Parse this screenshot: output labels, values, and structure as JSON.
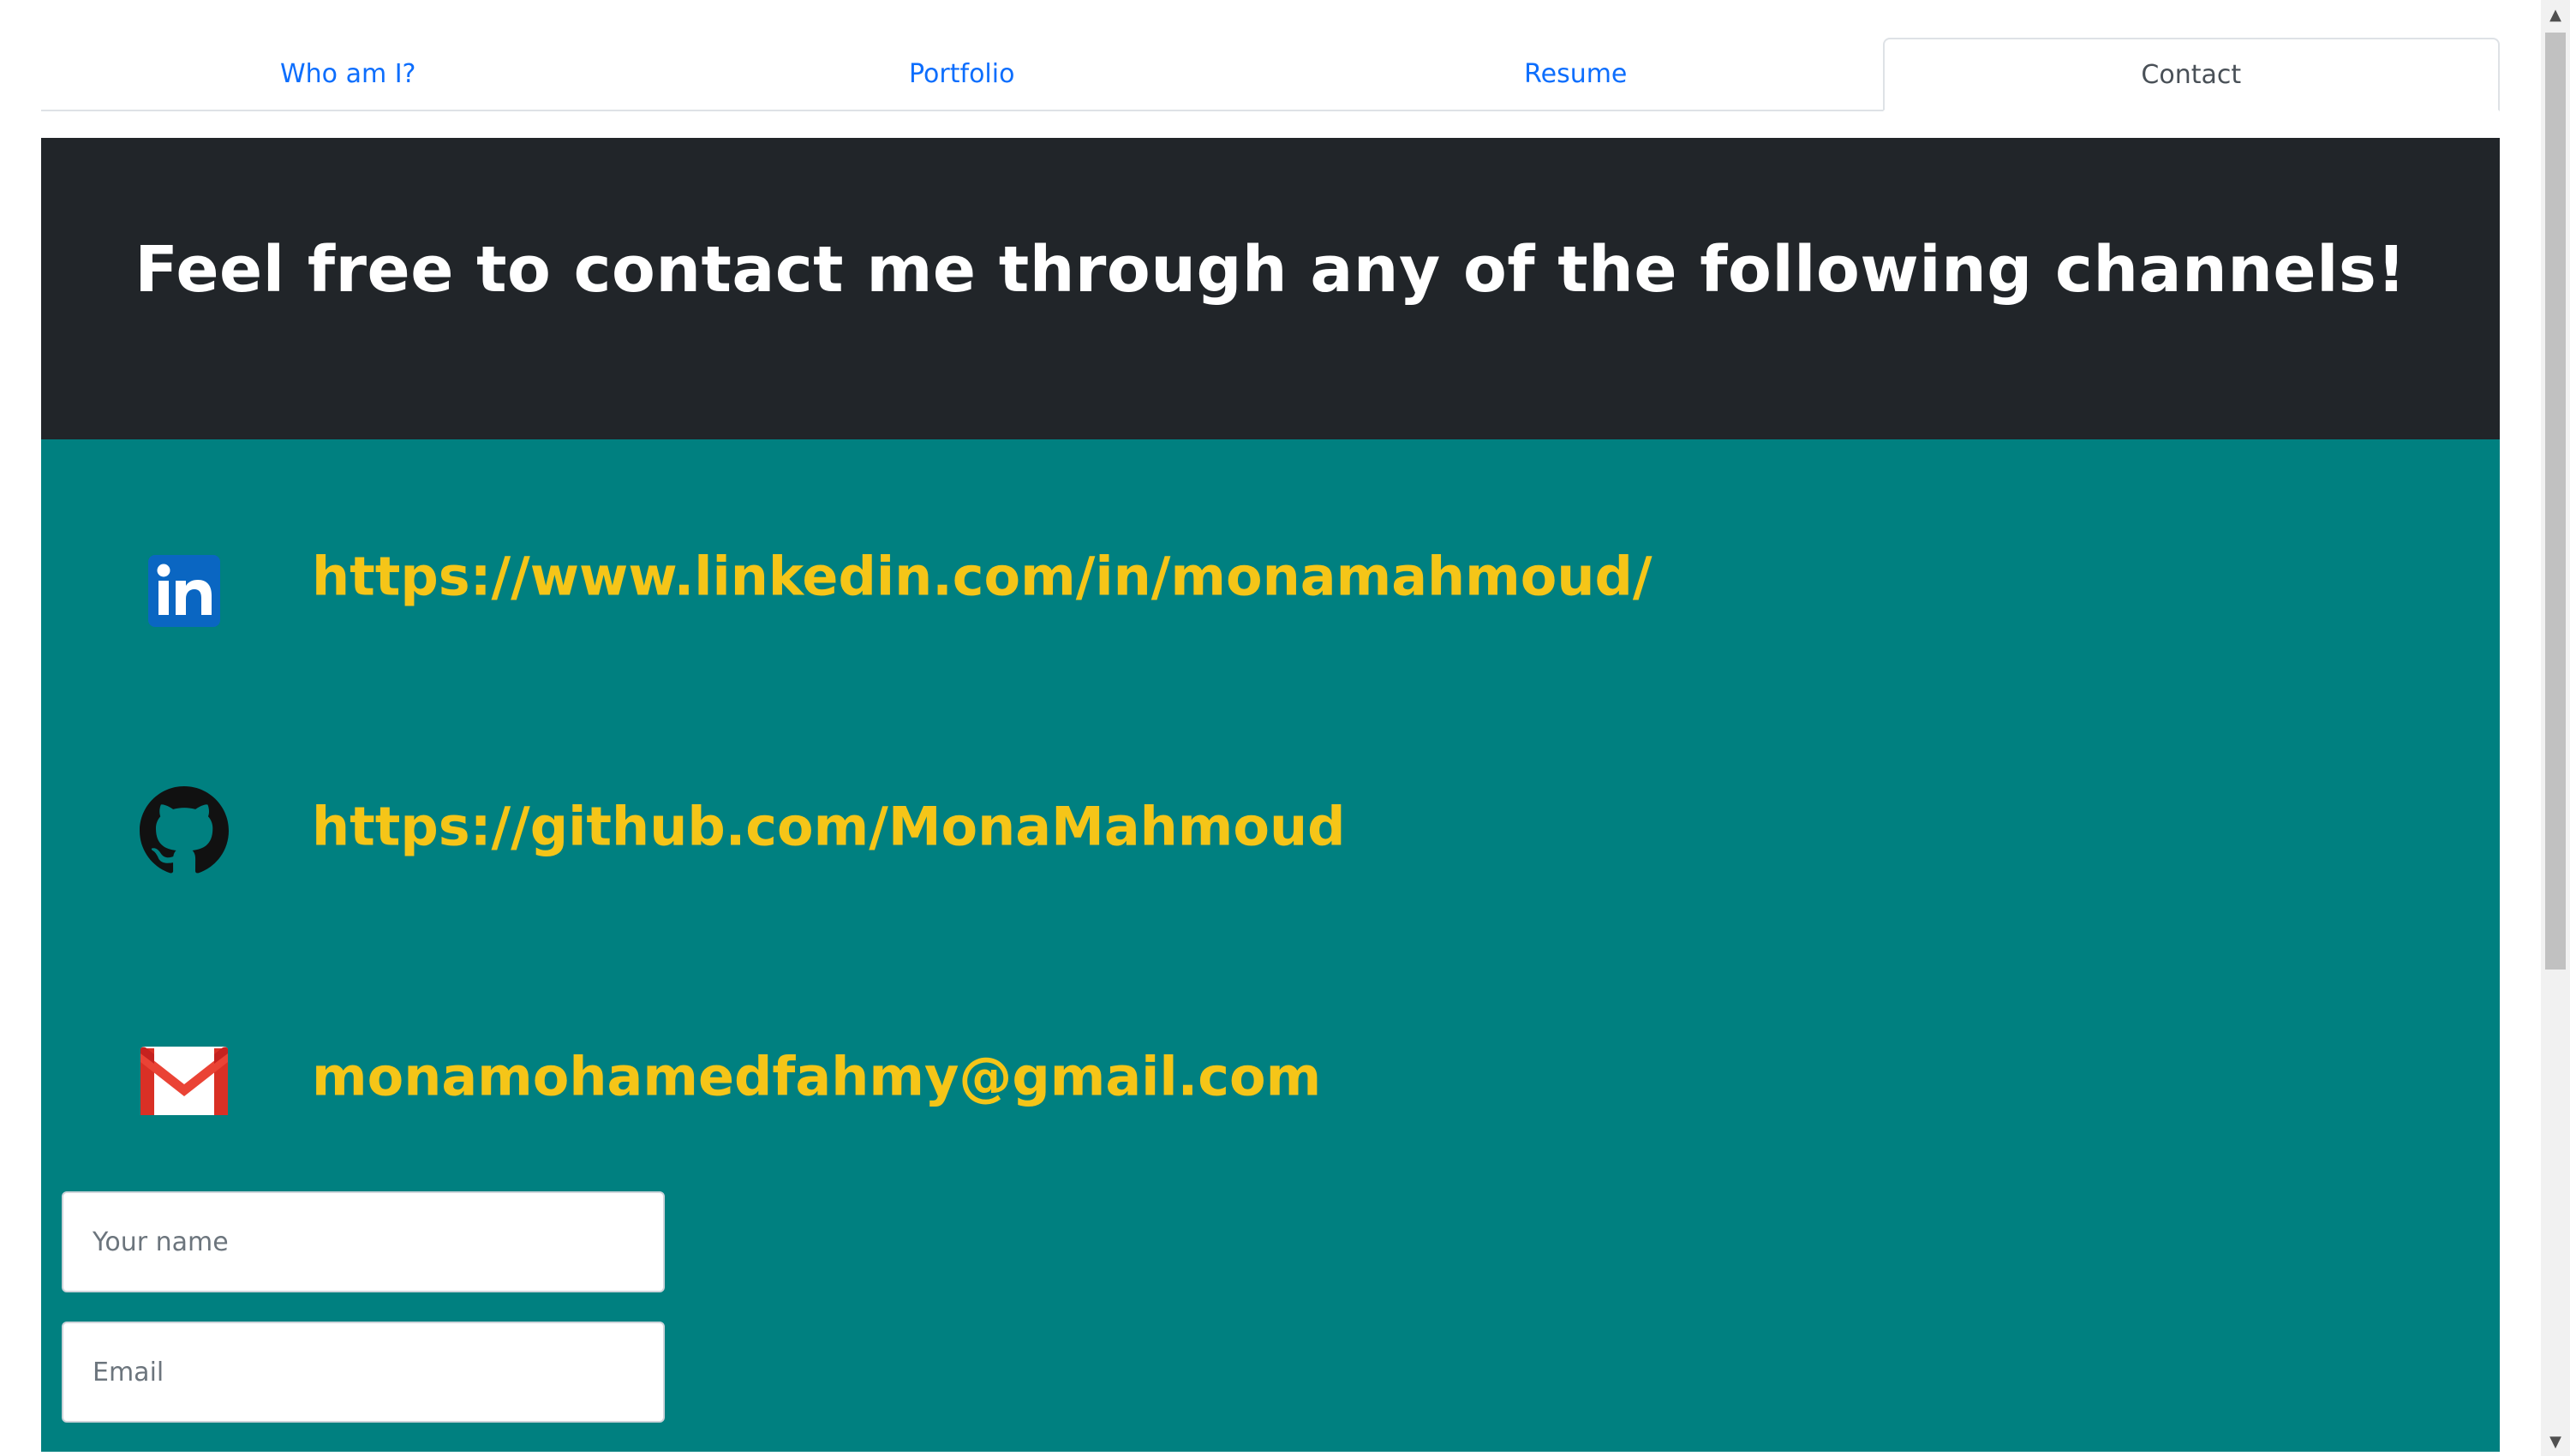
{
  "tabs": [
    {
      "label": "Who am I?",
      "active": false
    },
    {
      "label": "Portfolio",
      "active": false
    },
    {
      "label": "Resume",
      "active": false
    },
    {
      "label": "Contact",
      "active": true
    }
  ],
  "hero": {
    "title": "Feel free to contact me through any of the following channels!"
  },
  "channels": {
    "linkedin": {
      "icon": "linkedin-icon",
      "text": "https://www.linkedin.com/in/monamahmoud/"
    },
    "github": {
      "icon": "github-icon",
      "text": "https://github.com/MonaMahmoud"
    },
    "email": {
      "icon": "gmail-icon",
      "text": "monamohamedfahmy@gmail.com"
    }
  },
  "form": {
    "name_placeholder": "Your name",
    "email_placeholder": "Email"
  },
  "colors": {
    "accent_link": "#0d6efd",
    "hero_bg": "#212529",
    "contact_bg": "#008080",
    "channel_text": "#f5c518"
  }
}
